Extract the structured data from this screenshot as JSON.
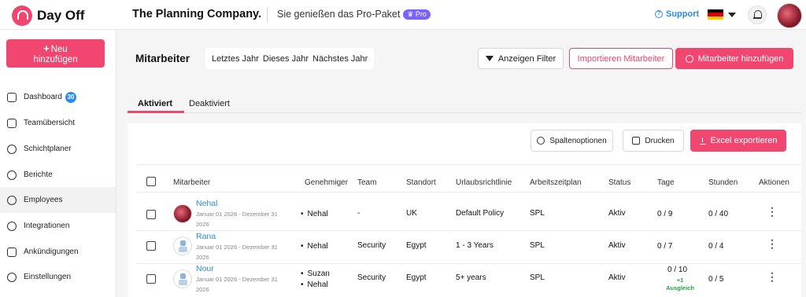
{
  "brand": {
    "name": "Day Off",
    "company": "The Planning Company.",
    "package_text": "Sie genießen das Pro-Paket",
    "pro_badge": "♛ Pro"
  },
  "header": {
    "support": "Support",
    "language_flag": "germany-flag-icon"
  },
  "sidebar": {
    "new_button": {
      "plus": "+",
      "line1": "Neu",
      "line2": "hinzufügen"
    },
    "items": [
      {
        "label": "Dashboard",
        "icon": "home-icon",
        "badge": "30"
      },
      {
        "label": "Teamübersicht",
        "icon": "calendar-icon"
      },
      {
        "label": "Schichtplaner",
        "icon": "shift-people-icon"
      },
      {
        "label": "Berichte",
        "icon": "pie-chart-icon"
      },
      {
        "label": "Employees",
        "icon": "person-icon",
        "active": true
      },
      {
        "label": "Integrationen",
        "icon": "plug-icon"
      },
      {
        "label": "Ankündigungen",
        "icon": "megaphone-icon"
      },
      {
        "label": "Einstellungen",
        "icon": "gear-icon"
      }
    ]
  },
  "main": {
    "title": "Mitarbeiter",
    "year_range": [
      "Letztes Jahr",
      "Dieses Jahr",
      "Nächstes Jahr"
    ],
    "filter_button": "Anzeigen Filter",
    "import_button": "Importieren Mitarbeiter",
    "add_button": "Mitarbeiter hinzufügen",
    "tabs": [
      "Aktiviert",
      "Deaktiviert"
    ],
    "tools": {
      "columns": "Spaltenoptionen",
      "print": "Drucken",
      "excel": "Excel exportieren"
    }
  },
  "table": {
    "headers": [
      "Mitarbeiter",
      "Genehmiger",
      "Team",
      "Standort",
      "Urlaubsrichtlinie",
      "Arbeitszeitplan",
      "Status",
      "Tage",
      "Stunden",
      "Aktionen"
    ],
    "rows": [
      {
        "name": "Nehal",
        "dates_line1": "Januar 01 2026 - Dezember 31",
        "dates_line2": "2026",
        "approvers": [
          "Nehal"
        ],
        "team": "-",
        "location": "UK",
        "policy": "Default Policy",
        "schedule": "SPL",
        "status": "Aktiv",
        "days": "0 / 9",
        "hours": "0 / 40",
        "avatar": "photo"
      },
      {
        "name": "Rana",
        "dates_line1": "Januar 01 2026 - Dezember 31",
        "dates_line2": "2026",
        "approvers": [
          "Nehal"
        ],
        "team": "Security",
        "location": "Egypt",
        "policy": "1 - 3 Years",
        "schedule": "SPL",
        "status": "Aktiv",
        "days": "0 / 7",
        "hours": "0 / 4",
        "avatar": "robot"
      },
      {
        "name": "Nour",
        "dates_line1": "Januar 01 2026 - Dezember 31",
        "dates_line2": "2026",
        "approvers": [
          "Suzan",
          "Nehal"
        ],
        "team": "Security",
        "location": "Egypt",
        "policy": "5+ years",
        "schedule": "SPL",
        "status": "Aktiv",
        "days": "0 / 10",
        "days_extra": "+1",
        "days_note": "Ausgleich",
        "hours": "0 / 5",
        "avatar": "robot"
      }
    ]
  },
  "colors": {
    "accent": "#f0466f",
    "link": "#2a8cf0",
    "pro": "#7b61ff",
    "positive": "#22a33c"
  }
}
